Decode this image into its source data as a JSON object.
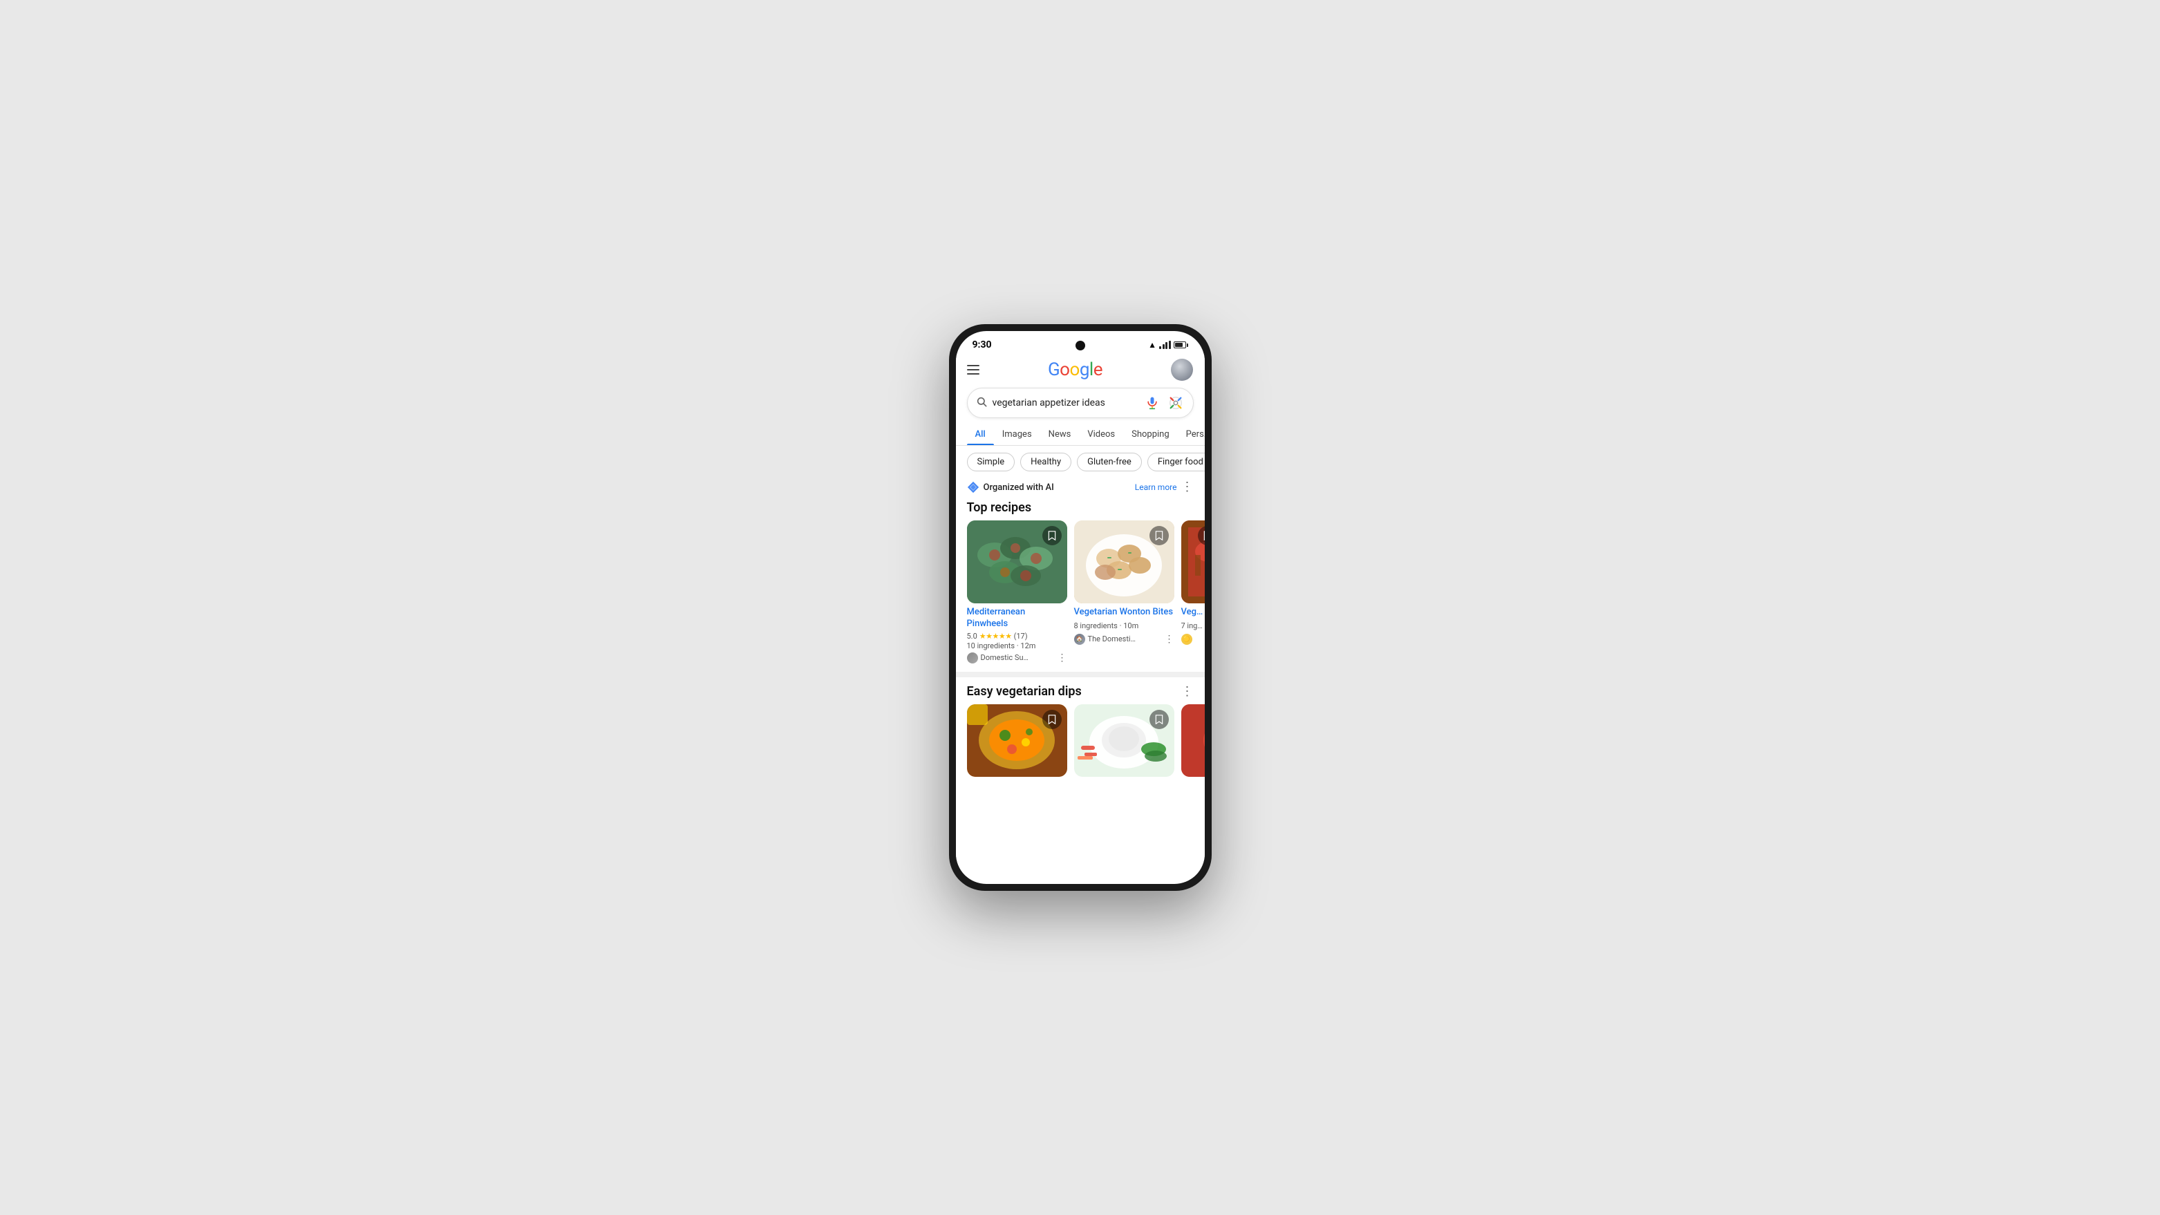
{
  "phone": {
    "status_bar": {
      "time": "9:30"
    },
    "header": {
      "google_logo": "Google",
      "hamburger_label": "menu"
    },
    "search": {
      "query": "vegetarian appetizer ideas",
      "voice_label": "voice search",
      "lens_label": "google lens"
    },
    "tabs": [
      {
        "label": "All",
        "active": true
      },
      {
        "label": "Images",
        "active": false
      },
      {
        "label": "News",
        "active": false
      },
      {
        "label": "Videos",
        "active": false
      },
      {
        "label": "Shopping",
        "active": false
      },
      {
        "label": "Pers…",
        "active": false
      }
    ],
    "chips": [
      {
        "label": "Simple"
      },
      {
        "label": "Healthy"
      },
      {
        "label": "Gluten-free"
      },
      {
        "label": "Finger food"
      }
    ],
    "ai_bar": {
      "label": "Organized with AI",
      "learn_more": "Learn more"
    },
    "top_recipes": {
      "section_title": "Top recipes",
      "cards": [
        {
          "title": "Mediterranean Pinwheels",
          "rating_value": "5.0",
          "rating_count": "17",
          "ingredients": "10 ingredients",
          "time": "12m",
          "source": "Domestic Su…",
          "img_class": "food-img-1"
        },
        {
          "title": "Vegetarian Wonton Bites",
          "rating_value": "",
          "rating_count": "",
          "ingredients": "8 ingredients",
          "time": "10m",
          "source": "The Domesti…",
          "img_class": "food-img-2"
        },
        {
          "title": "Veg…",
          "rating_value": "",
          "rating_count": "",
          "ingredients": "7 ing…",
          "time": "",
          "source": "",
          "img_class": "food-img-3"
        }
      ]
    },
    "easy_dips": {
      "section_title": "Easy vegetarian dips",
      "cards": [
        {
          "img_class": "food-img-4"
        },
        {
          "img_class": "food-img-5"
        },
        {
          "img_class": "food-img-3"
        }
      ]
    }
  }
}
